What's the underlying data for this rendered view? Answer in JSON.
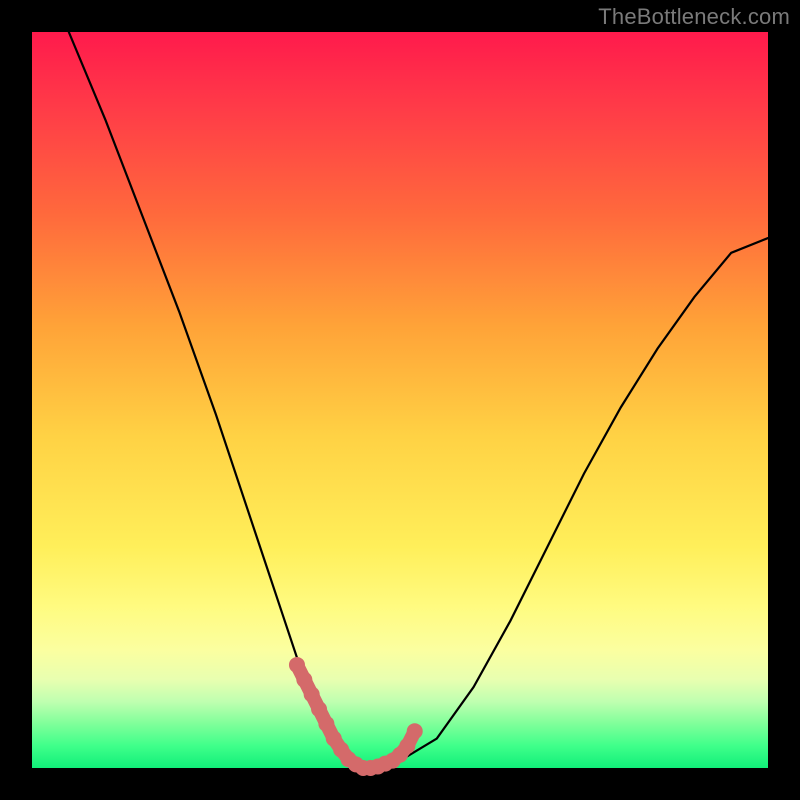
{
  "watermark": "TheBottleneck.com",
  "chart_data": {
    "type": "line",
    "title": "",
    "xlabel": "",
    "ylabel": "",
    "xlim": [
      0,
      100
    ],
    "ylim": [
      0,
      100
    ],
    "grid": false,
    "series": [
      {
        "name": "bottleneck-curve",
        "x": [
          5,
          10,
          15,
          20,
          25,
          30,
          32,
          34,
          36,
          38,
          40,
          42,
          44,
          46,
          48,
          50,
          55,
          60,
          65,
          70,
          75,
          80,
          85,
          90,
          95,
          100
        ],
        "y": [
          100,
          88,
          75,
          62,
          48,
          33,
          27,
          21,
          15,
          10,
          6,
          3,
          1,
          0,
          0,
          1,
          4,
          11,
          20,
          30,
          40,
          49,
          57,
          64,
          70,
          72
        ]
      },
      {
        "name": "optimal-zone-overlay",
        "x": [
          36,
          37,
          38,
          39,
          40,
          41,
          42,
          43,
          44,
          45,
          46,
          47,
          48,
          49,
          50,
          51,
          52
        ],
        "y": [
          14,
          12,
          10,
          8,
          6,
          4,
          2.5,
          1.2,
          0.5,
          0,
          0,
          0.2,
          0.6,
          1,
          1.8,
          3,
          5
        ]
      }
    ],
    "annotations": []
  },
  "colors": {
    "background_frame": "#000000",
    "curve": "#000000",
    "overlay": "#d46a6a",
    "watermark": "#7a7a7a"
  }
}
